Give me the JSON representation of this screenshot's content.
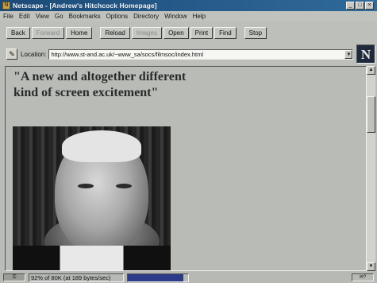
{
  "window": {
    "title": "Netscape - [Andrew's Hitchcock Homepage]",
    "app_icon": "netscape-app-icon",
    "controls": {
      "minimize": "_",
      "maximize": "□",
      "close": "×"
    }
  },
  "menu": [
    "File",
    "Edit",
    "View",
    "Go",
    "Bookmarks",
    "Options",
    "Directory",
    "Window",
    "Help"
  ],
  "toolbar": {
    "back": "Back",
    "forward": "Forward",
    "home": "Home",
    "reload": "Reload",
    "images": "Images",
    "open": "Open",
    "print": "Print",
    "find": "Find",
    "stop": "Stop"
  },
  "location": {
    "label": "Location:",
    "url": "http://www.st-and.ac.uk/~www_sa/socs/filmsoc/index.html"
  },
  "logo": "N",
  "page": {
    "headline": "\"A new and altogether different kind of screen excitement\""
  },
  "status": {
    "text": "92% of 80K (at 189 bytes/sec)",
    "progress": 0.92
  }
}
